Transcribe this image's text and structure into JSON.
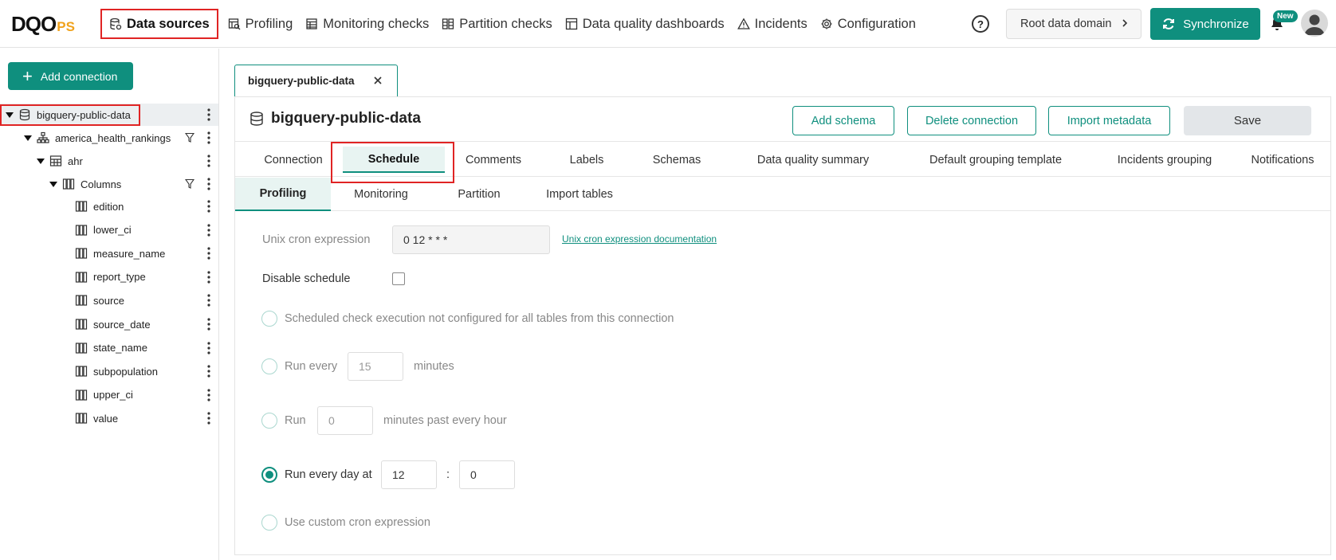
{
  "brand": {
    "logo_main": "DQO",
    "logo_suffix": "PS"
  },
  "nav": {
    "items": [
      {
        "label": "Data sources",
        "icon": "database-icon"
      },
      {
        "label": "Profiling",
        "icon": "profiling-icon"
      },
      {
        "label": "Monitoring checks",
        "icon": "monitoring-icon"
      },
      {
        "label": "Partition checks",
        "icon": "partition-icon"
      },
      {
        "label": "Data quality dashboards",
        "icon": "dashboard-icon"
      },
      {
        "label": "Incidents",
        "icon": "warning-icon"
      },
      {
        "label": "Configuration",
        "icon": "gear-icon"
      }
    ],
    "active_index": 0
  },
  "header": {
    "help_label": "?",
    "domain_label": "Root data domain",
    "sync_label": "Synchronize",
    "new_badge": "New"
  },
  "sidebar": {
    "add_connection_label": "Add connection",
    "tree": {
      "connection": "bigquery-public-data",
      "schema": "america_health_rankings",
      "table": "ahr",
      "columns_folder": "Columns",
      "columns": [
        "edition",
        "lower_ci",
        "measure_name",
        "report_type",
        "source",
        "source_date",
        "state_name",
        "subpopulation",
        "upper_ci",
        "value"
      ]
    }
  },
  "main": {
    "open_tab": "bigquery-public-data",
    "title": "bigquery-public-data",
    "actions": {
      "add_schema": "Add schema",
      "delete_connection": "Delete connection",
      "import_metadata": "Import metadata",
      "save": "Save"
    },
    "tabs": [
      "Connection",
      "Schedule",
      "Comments",
      "Labels",
      "Schemas",
      "Data quality summary",
      "Default grouping template",
      "Incidents grouping",
      "Notifications"
    ],
    "active_tab": "Schedule",
    "subtabs": [
      "Profiling",
      "Monitoring",
      "Partition",
      "Import tables"
    ],
    "active_subtab": "Profiling"
  },
  "schedule": {
    "cron_label": "Unix cron expression",
    "cron_value": "0 12 * * *",
    "cron_doc_link": "Unix cron expression documentation",
    "disable_label": "Disable schedule",
    "disable_checked": false,
    "option_not_configured": "Scheduled check execution not configured for all tables from this connection",
    "option_run_every": "Run every",
    "run_every_value": "15",
    "minutes_label": "minutes",
    "option_run": "Run",
    "run_past_value": "0",
    "minutes_past_label": "minutes past every hour",
    "option_run_daily": "Run every day at",
    "daily_hour": "12",
    "time_sep": ":",
    "daily_minute": "0",
    "option_custom": "Use custom cron expression",
    "selected_option": "Run every day at"
  },
  "colors": {
    "accent": "#0f8f7e",
    "highlight": "#e02424",
    "logo_suffix": "#f0a21c"
  }
}
